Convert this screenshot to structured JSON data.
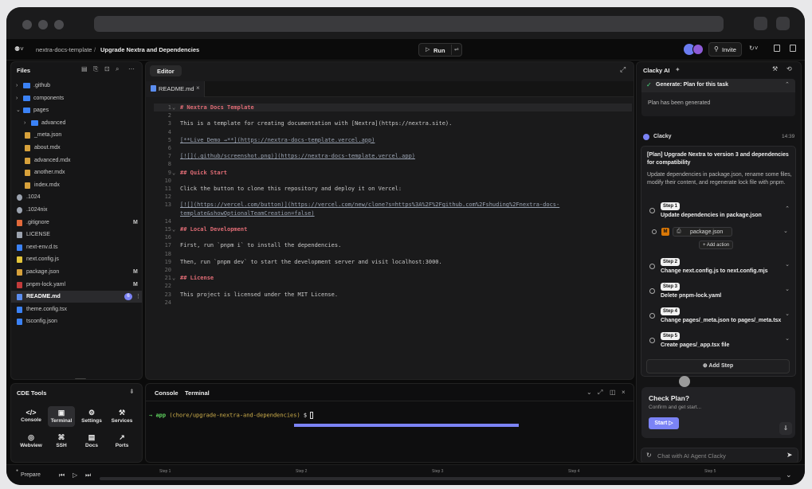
{
  "topbar": {
    "repo": "nextra-docs-template",
    "sep": "/",
    "task": "Upgrade Nextra and Dependencies",
    "run": "Run",
    "invite": "Invite"
  },
  "files": {
    "title": "Files",
    "items": [
      {
        "name": ".github",
        "type": "folder",
        "depth": 0,
        "open": false
      },
      {
        "name": "components",
        "type": "folder",
        "depth": 0,
        "open": false
      },
      {
        "name": "pages",
        "type": "folder",
        "depth": 0,
        "open": true
      },
      {
        "name": "advanced",
        "type": "folder",
        "depth": 1,
        "open": false
      },
      {
        "name": "_meta.json",
        "type": "json",
        "depth": 1
      },
      {
        "name": "about.mdx",
        "type": "mdx",
        "depth": 1
      },
      {
        "name": "advanced.mdx",
        "type": "mdx",
        "depth": 1
      },
      {
        "name": "another.mdx",
        "type": "mdx",
        "depth": 1
      },
      {
        "name": "index.mdx",
        "type": "mdx",
        "depth": 1
      },
      {
        "name": ".1024",
        "type": "gear",
        "depth": 0
      },
      {
        "name": ".1024nix",
        "type": "gear",
        "depth": 0
      },
      {
        "name": ".gitignore",
        "type": "git",
        "depth": 0,
        "badge": "M"
      },
      {
        "name": "LICENSE",
        "type": "txt",
        "depth": 0
      },
      {
        "name": "next-env.d.ts",
        "type": "ts",
        "depth": 0
      },
      {
        "name": "next.config.js",
        "type": "js",
        "depth": 0
      },
      {
        "name": "package.json",
        "type": "json",
        "depth": 0,
        "badge": "M"
      },
      {
        "name": "pnpm-lock.yaml",
        "type": "yaml",
        "depth": 0,
        "badge": "M"
      },
      {
        "name": "README.md",
        "type": "md",
        "depth": 0,
        "active": true,
        "count": "6"
      },
      {
        "name": "theme.config.tsx",
        "type": "tsx",
        "depth": 0
      },
      {
        "name": "tsconfig.json",
        "type": "ts",
        "depth": 0
      }
    ]
  },
  "editor": {
    "tab": "Editor",
    "file_tab": "README.md",
    "lines": [
      {
        "n": "1",
        "fold": true,
        "t": "# Nextra Docs Template",
        "k": "hd"
      },
      {
        "n": "2",
        "t": ""
      },
      {
        "n": "3",
        "t": "This is a template for creating documentation with [Nextra](https://nextra.site).",
        "k": "p"
      },
      {
        "n": "4",
        "t": ""
      },
      {
        "n": "5",
        "t": "[**Live Demo →**](https://nextra-docs-template.vercel.app)",
        "k": "link"
      },
      {
        "n": "6",
        "t": ""
      },
      {
        "n": "7",
        "t": "[![](.github/screenshot.png)](https://nextra-docs-template.vercel.app)",
        "k": "link"
      },
      {
        "n": "8",
        "t": ""
      },
      {
        "n": "9",
        "fold": true,
        "t": "## Quick Start",
        "k": "hd"
      },
      {
        "n": "10",
        "t": ""
      },
      {
        "n": "11",
        "t": "Click the button to clone this repository and deploy it on Vercel:",
        "k": "p"
      },
      {
        "n": "12",
        "t": ""
      },
      {
        "n": "13",
        "t": "[![](https://vercel.com/button)](https://vercel.com/new/clone?s=https%3A%2F%2Fgithub.com%2Fshuding%2Fnextra-docs-",
        "k": "link"
      },
      {
        "n": "",
        "t": "template&showOptionalTeamCreation=false)",
        "k": "link"
      },
      {
        "n": "14",
        "t": ""
      },
      {
        "n": "15",
        "fold": true,
        "t": "## Local Development",
        "k": "hd"
      },
      {
        "n": "16",
        "t": ""
      },
      {
        "n": "17",
        "t": "First, run `pnpm i` to install the dependencies.",
        "k": "p"
      },
      {
        "n": "18",
        "t": ""
      },
      {
        "n": "19",
        "t": "Then, run `pnpm dev` to start the development server and visit localhost:3000.",
        "k": "p"
      },
      {
        "n": "20",
        "t": ""
      },
      {
        "n": "21",
        "fold": true,
        "t": "## License",
        "k": "hd"
      },
      {
        "n": "22",
        "t": ""
      },
      {
        "n": "23",
        "t": "This project is licensed under the MIT License.",
        "k": "p"
      },
      {
        "n": "24",
        "t": ""
      }
    ]
  },
  "cde": {
    "title": "CDE Tools",
    "tools": [
      {
        "label": "Console",
        "icon": "</>"
      },
      {
        "label": "Terminal",
        "icon": "▣",
        "active": true
      },
      {
        "label": "Settings",
        "icon": "⚙"
      },
      {
        "label": "Services",
        "icon": "⚒"
      },
      {
        "label": "Webview",
        "icon": "◎"
      },
      {
        "label": "SSH",
        "icon": "⌘"
      },
      {
        "label": "Docs",
        "icon": "▤"
      },
      {
        "label": "Ports",
        "icon": "↗"
      }
    ]
  },
  "terminal": {
    "tab1": "Console",
    "tab2": "Terminal",
    "prompt_arrow": "→",
    "prompt_dir": "app",
    "prompt_branch": "(chore/upgrade-nextra-and-dependencies)",
    "prompt_sym": "$"
  },
  "ai": {
    "title": "Clacky AI",
    "gen_title": "Generate: Plan for this task",
    "gen_status": "Plan has been generated",
    "author": "Clacky",
    "time": "14:39",
    "plan_title": "[Plan] Upgrade Nextra to version 3 and dependencies for compatibility",
    "plan_desc": "Update dependencies in package.json, rename some files, modify their content, and regenerate lock file with pnpm.",
    "steps": [
      {
        "badge": "Step 1",
        "title": "Update dependencies in package.json",
        "file": "package.json",
        "file_badge": "M",
        "action": "+ Add action"
      },
      {
        "badge": "Step 2",
        "title": "Change next.config.js to next.config.mjs"
      },
      {
        "badge": "Step 3",
        "title": "Delete pnpm-lock.yaml"
      },
      {
        "badge": "Step 4",
        "title": "Change pages/_meta.json to pages/_meta.tsx"
      },
      {
        "badge": "Step 5",
        "title": "Create pages/_app.tsx file"
      }
    ],
    "add_step": "⊕ Add Step",
    "check_title": "Check Plan?",
    "check_desc": "Confirm and get start...",
    "start": "Start ▷",
    "chat_placeholder": "Chat with AI Agent Clacky"
  },
  "timeline": {
    "prepare": "Prepare",
    "steps": [
      "Step 1",
      "Step 2",
      "Step 3",
      "Step 4",
      "Step 5"
    ]
  },
  "colors": {
    "accent": "#7b83f5",
    "folder": "#3b82f6",
    "heading": "#e06c75",
    "prompt": "#5fd35f"
  }
}
